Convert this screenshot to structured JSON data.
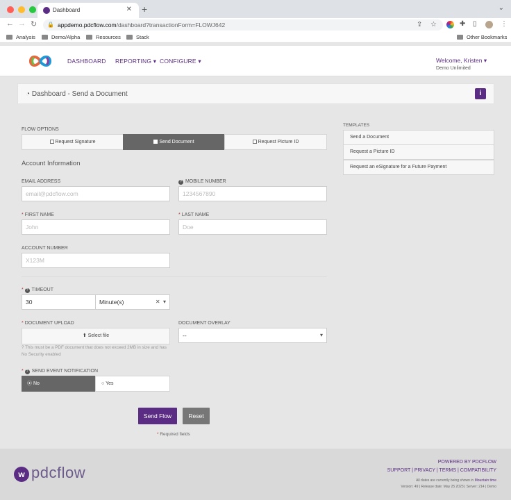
{
  "browser": {
    "tab_title": "Dashboard",
    "new_tab": "+",
    "url_host": "appdemo.pdcflow.com",
    "url_path": "/dashboard?transactionForm=FLOWJ642",
    "bookmarks": [
      "Analysis",
      "Demo/Alpha",
      "Resources",
      "Stack"
    ],
    "other_bookmarks": "Other Bookmarks"
  },
  "header": {
    "nav": [
      "DASHBOARD",
      "REPORTING",
      "CONFIGURE"
    ],
    "welcome": "Welcome, Kristen",
    "org": "Demo Unlimited"
  },
  "page": {
    "title": "Dashboard - Send a Document"
  },
  "form": {
    "flow_options_label": "FLOW OPTIONS",
    "flow_options": [
      "Request Signature",
      "Send Document",
      "Request Picture ID"
    ],
    "section_title": "Account Information",
    "email_label": "EMAIL ADDRESS",
    "email_placeholder": "email@pdcflow.com",
    "mobile_label": "MOBILE NUMBER",
    "mobile_placeholder": "1234567890",
    "first_name_label": "FIRST NAME",
    "first_name_placeholder": "John",
    "last_name_label": "LAST NAME",
    "last_name_placeholder": "Doe",
    "account_label": "ACCOUNT NUMBER",
    "account_placeholder": "X123M",
    "timeout_label": "TIMEOUT",
    "timeout_value": "30",
    "timeout_unit": "Minute(s)",
    "upload_label": "DOCUMENT UPLOAD",
    "select_file": "Select file",
    "upload_help": "This must be a PDF document that does not exceed 2MB in size and has No Security enabled",
    "overlay_label": "DOCUMENT OVERLAY",
    "overlay_value": "--",
    "notify_label": "SEND EVENT NOTIFICATION",
    "notify_no": "No",
    "notify_yes": "Yes",
    "send_button": "Send Flow",
    "reset_button": "Reset",
    "required_note": "Required fields"
  },
  "templates": {
    "title": "TEMPLATES",
    "items": [
      "Send a Document",
      "Request a Picture ID",
      "Request an eSignature for a Future Payment"
    ]
  },
  "footer": {
    "logo_text": "pdcflow",
    "powered_by": "POWERED BY PDCFLOW",
    "links": "SUPPORT | PRIVACY | TERMS | COMPATIBILITY",
    "timezone_prefix": "All dates are currently being shown in ",
    "timezone": "Mountain time",
    "version": "Version: 49 | Release date: May 25 2023 | Server: 214 | Demo"
  },
  "colors": {
    "brand": "#5b2c83",
    "active_segment": "#666666",
    "reset": "#777777"
  }
}
